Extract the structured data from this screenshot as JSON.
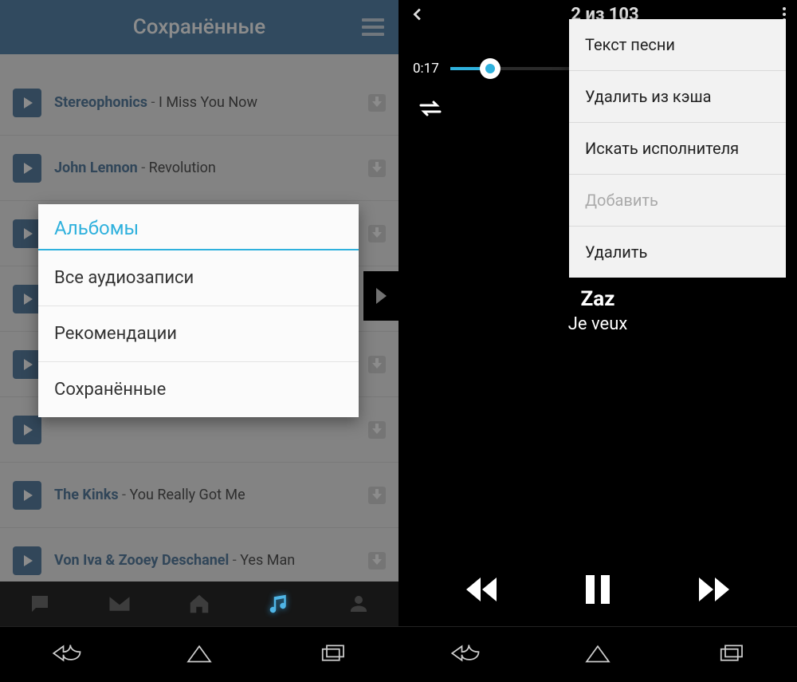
{
  "left": {
    "header_title": "Сохранённые",
    "tracks": [
      {
        "artist": "Stereophonics",
        "title": "I Miss You Now"
      },
      {
        "artist": "John Lennon",
        "title": "Revolution"
      },
      {
        "artist": "",
        "title": ""
      },
      {
        "artist": "",
        "title": ""
      },
      {
        "artist": "",
        "title": ""
      },
      {
        "artist": "",
        "title": ""
      },
      {
        "artist": "The Kinks",
        "title": "You Really Got Me"
      },
      {
        "artist": "Von Iva &  Zooey Deschanel",
        "title": "Yes Man"
      }
    ],
    "popup": {
      "title": "Альбомы",
      "items": [
        "Все аудиозаписи",
        "Рекомендации",
        "Сохранённые"
      ]
    }
  },
  "right": {
    "counter": "2 из 103",
    "elapsed": "0:17",
    "menu": [
      {
        "label": "Текст песни",
        "disabled": false
      },
      {
        "label": "Удалить из кэша",
        "disabled": false
      },
      {
        "label": "Искать исполнителя",
        "disabled": false
      },
      {
        "label": "Добавить",
        "disabled": true
      },
      {
        "label": "Удалить",
        "disabled": false
      }
    ],
    "now_playing": {
      "artist": "Zaz",
      "title": "Je veux"
    }
  }
}
